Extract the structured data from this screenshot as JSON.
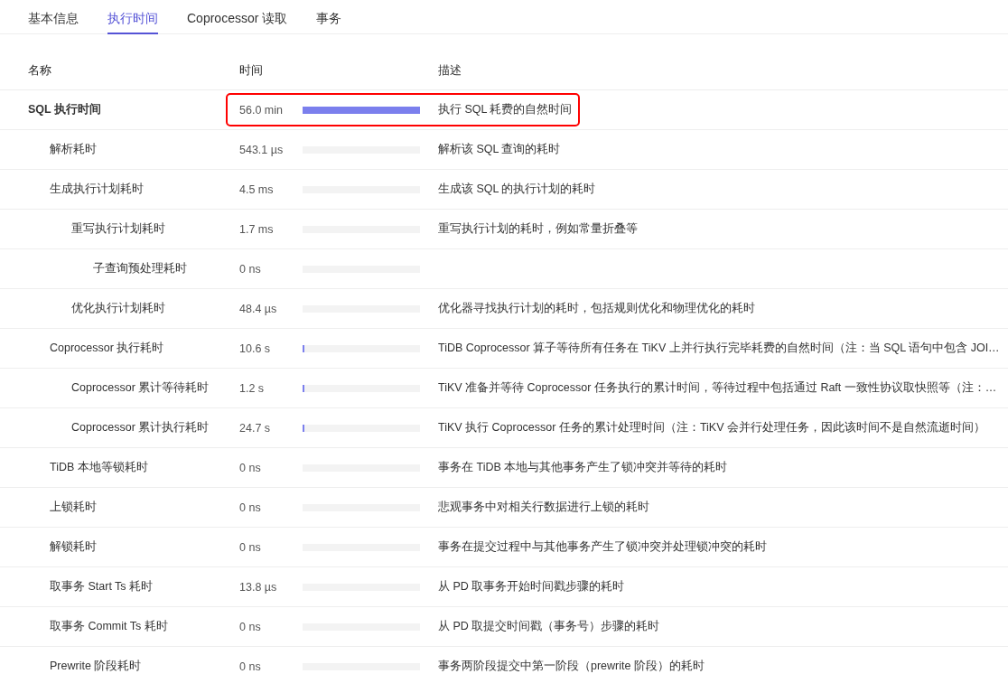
{
  "tabs": [
    {
      "label": "基本信息",
      "selected": false
    },
    {
      "label": "执行时间",
      "selected": true
    },
    {
      "label": "Coprocessor 读取",
      "selected": false
    },
    {
      "label": "事务",
      "selected": false
    }
  ],
  "table": {
    "columns": [
      "名称",
      "时间",
      "描述"
    ],
    "rows": [
      {
        "name": "SQL 执行时间",
        "time": "56.0 min",
        "level": 1,
        "description": "执行 SQL 耗费的自然时间",
        "highlighted": true,
        "children": [
          {
            "name": "解析耗时",
            "time": "543.1 µs",
            "level": 0,
            "description": "解析该 SQL 查询的耗时",
            "highlighted": false
          },
          {
            "name": "生成执行计划耗时",
            "time": "4.5 ms",
            "level": 0,
            "description": "生成该 SQL 的执行计划的耗时",
            "highlighted": false,
            "children": [
              {
                "name": "重写执行计划耗时",
                "time": "1.7 ms",
                "level": 0,
                "description": "重写执行计划的耗时，例如常量折叠等",
                "highlighted": false,
                "children": [
                  {
                    "name": "子查询预处理耗时",
                    "time": "0 ns",
                    "level": 0,
                    "highlighted": false
                  }
                ]
              },
              {
                "name": "优化执行计划耗时",
                "time": "48.4 µs",
                "level": 0,
                "description": "优化器寻找执行计划的耗时，包括规则优化和物理优化的耗时",
                "highlighted": false
              }
            ]
          },
          {
            "name": "Coprocessor 执行耗时",
            "time": "10.6 s",
            "level": 0.003,
            "description": "TiDB Coprocessor 算子等待所有任务在 TiKV 上并行执行完毕耗费的自然时间（注：当 SQL 语句中包含 JOI…",
            "highlighted": false,
            "children": [
              {
                "name": "Coprocessor 累计等待耗时",
                "time": "1.2 s",
                "level": 0.0004,
                "description": "TiKV 准备并等待 Coprocessor 任务执行的累计时间，等待过程中包括通过 Raft 一致性协议取快照等（注：…",
                "highlighted": false
              },
              {
                "name": "Coprocessor 累计执行耗时",
                "time": "24.7 s",
                "level": 0.007,
                "description": "TiKV 执行 Coprocessor 任务的累计处理时间（注：TiKV 会并行处理任务，因此该时间不是自然流逝时间）",
                "highlighted": false
              }
            ]
          },
          {
            "name": "TiDB 本地等锁耗时",
            "time": "0 ns",
            "level": 0,
            "description": "事务在 TiDB 本地与其他事务产生了锁冲突并等待的耗时",
            "highlighted": false
          },
          {
            "name": "上锁耗时",
            "time": "0 ns",
            "level": 0,
            "description": "悲观事务中对相关行数据进行上锁的耗时",
            "highlighted": false
          },
          {
            "name": "解锁耗时",
            "time": "0 ns",
            "level": 0,
            "description": "事务在提交过程中与其他事务产生了锁冲突并处理锁冲突的耗时",
            "highlighted": false
          },
          {
            "name": "取事务 Start Ts 耗时",
            "time": "13.8 µs",
            "level": 0,
            "description": "从 PD 取事务开始时间戳步骤的耗时",
            "highlighted": false
          },
          {
            "name": "取事务 Commit Ts 耗时",
            "time": "0 ns",
            "level": 0,
            "description": "从 PD 取提交时间戳（事务号）步骤的耗时",
            "highlighted": false
          },
          {
            "name": "Prewrite 阶段耗时",
            "time": "0 ns",
            "level": 0,
            "description": "事务两阶段提交中第一阶段（prewrite 阶段）的耗时",
            "highlighted": false
          }
        ]
      }
    ]
  }
}
